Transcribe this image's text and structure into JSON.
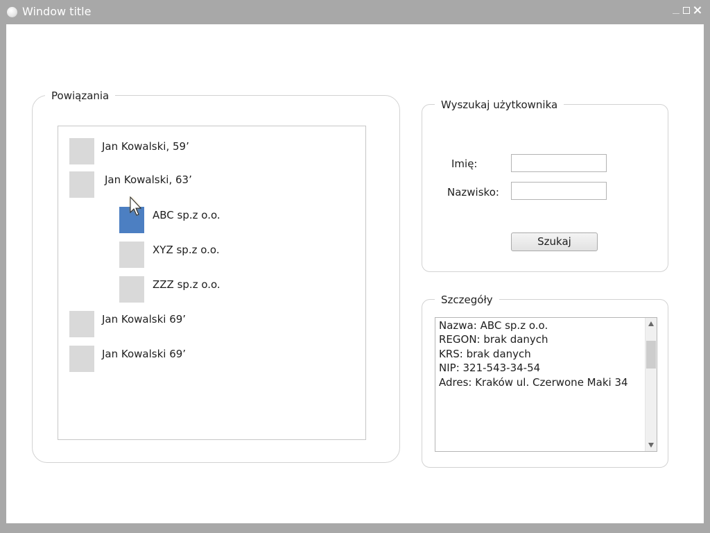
{
  "window": {
    "title": "Window title"
  },
  "relations": {
    "legend": "Powiązania",
    "tree": [
      {
        "label": "Jan Kowalski, 59’",
        "selected": false
      },
      {
        "label": "Jan Kowalski, 63’",
        "selected": false
      },
      {
        "label": "ABC sp.z o.o.",
        "selected": true
      },
      {
        "label": "XYZ sp.z o.o.",
        "selected": false
      },
      {
        "label": "ZZZ sp.z o.o.",
        "selected": false
      },
      {
        "label": "Jan Kowalski 69’",
        "selected": false
      },
      {
        "label": "Jan Kowalski 69’",
        "selected": false
      }
    ]
  },
  "search": {
    "legend": "Wyszukaj użytkownika",
    "first_name_label": "Imię:",
    "first_name_value": "",
    "last_name_label": "Nazwisko:",
    "last_name_value": "",
    "button_label": "Szukaj"
  },
  "details": {
    "legend": "Szczegóły",
    "lines": [
      "Nazwa: ABC sp.z o.o.",
      "REGON: brak danych",
      "KRS: brak danych",
      "NIP: 321-543-34-54",
      "Adres: Kraków ul. Czerwone Maki 34"
    ]
  },
  "colors": {
    "frame": "#a8a8a8",
    "selected_item": "#4c7fc2",
    "item_square": "#d9d9d9"
  },
  "icons": {
    "app": "circle-app-icon",
    "minimize": "minimize-icon",
    "maximize": "maximize-icon",
    "close": "close-icon",
    "cursor": "mouse-pointer-icon"
  }
}
